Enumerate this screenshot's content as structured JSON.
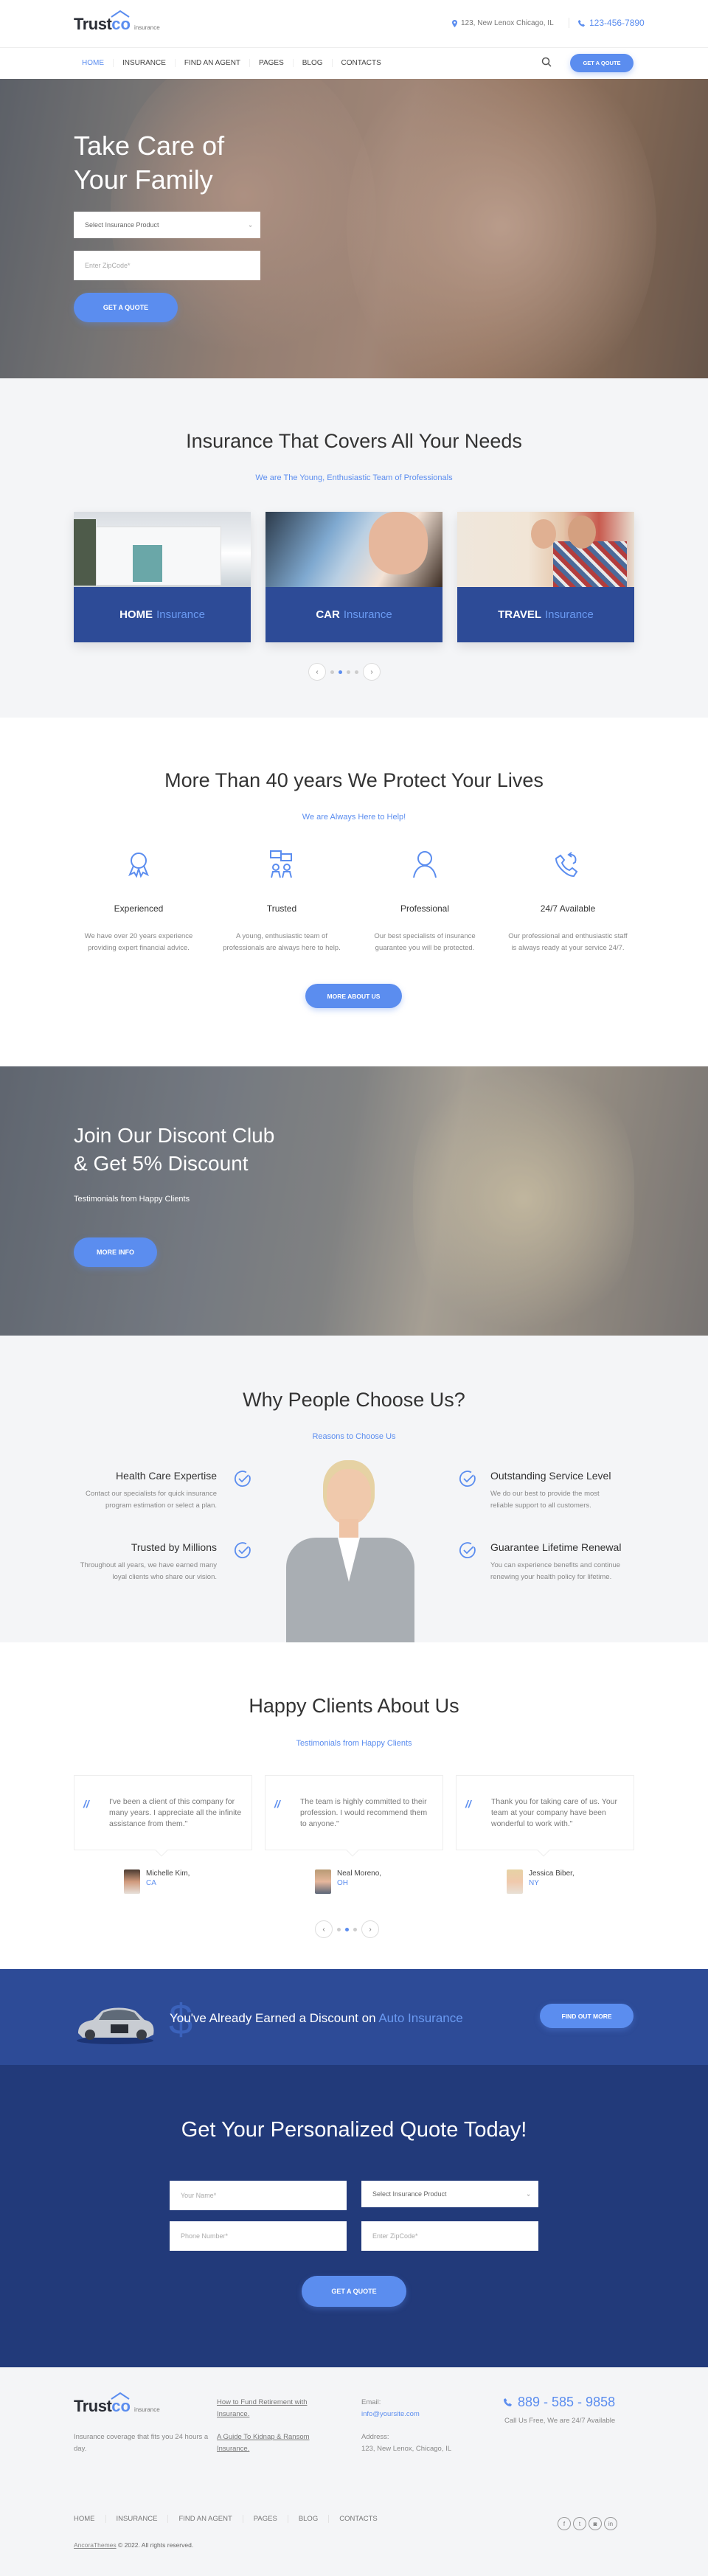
{
  "brand": {
    "name_part1": "Trust",
    "name_part2": "co",
    "tagline": "insurance"
  },
  "topbar": {
    "address": "123, New Lenox Chicago, IL",
    "phone": "123-456-7890"
  },
  "nav": {
    "items": [
      "HOME",
      "INSURANCE",
      "FIND AN AGENT",
      "PAGES",
      "BLOG",
      "CONTACTS"
    ],
    "active": "HOME",
    "cta": "GET A QOUTE"
  },
  "hero": {
    "title_line1": "Take Care of",
    "title_line2": "Your Family",
    "select_placeholder": "Select Insurance Product",
    "zip_placeholder": "Enter ZipCode*",
    "button": "GET A QUOTE"
  },
  "coverage": {
    "title": "Insurance That Covers All Your Needs",
    "subtitle": "We are The Young, Enthusiastic Team of Professionals",
    "cards": [
      {
        "bold": "HOME",
        "light": "Insurance"
      },
      {
        "bold": "CAR",
        "light": "Insurance"
      },
      {
        "bold": "TRAVEL",
        "light": "Insurance"
      }
    ],
    "pager": {
      "dots": 4,
      "active": 2
    }
  },
  "protect": {
    "title": "More Than 40 years We Protect Your Lives",
    "subtitle": "We are Always Here to Help!",
    "features": [
      {
        "icon": "award-ribbon-icon",
        "title": "Experienced",
        "desc_line1": "We have over 20 years experience",
        "desc_line2": "providing expert financial advice."
      },
      {
        "icon": "team-chat-icon",
        "title": "Trusted",
        "desc_line1": "A young, enthusiastic team of",
        "desc_line2": "professionals are always here to help."
      },
      {
        "icon": "user-icon",
        "title": "Professional",
        "desc_line1": "Our best specialists of insurance",
        "desc_line2": "guarantee you will be protected."
      },
      {
        "icon": "phone-callback-icon",
        "title": "24/7 Available",
        "desc_line1": "Our professional and enthusiastic staff",
        "desc_line2": "is always ready at your service 24/7."
      }
    ],
    "button": "MORE ABOUT US"
  },
  "discount": {
    "title_line1": "Join Our Discont Club",
    "title_line2": "& Get 5% Discount",
    "subtitle": "Testimonials from Happy Clients",
    "button": "MORE INFO"
  },
  "why": {
    "title": "Why People Choose Us?",
    "subtitle": "Reasons to Choose Us",
    "left": [
      {
        "title": "Health Care Expertise",
        "desc_line1": "Contact our specialists for quick insurance",
        "desc_line2": "program estimation or select a plan."
      },
      {
        "title": "Trusted by Millions",
        "desc_line1": "Throughout all years, we have earned many",
        "desc_line2": "loyal clients who share our vision."
      }
    ],
    "right": [
      {
        "title": "Outstanding Service Level",
        "desc_line1": "We do our best to provide the most",
        "desc_line2": "reliable support to all customers."
      },
      {
        "title": "Guarantee Lifetime Renewal",
        "desc_line1": "You can experience benefits and continue",
        "desc_line2": "renewing your health policy for lifetime."
      }
    ]
  },
  "testimonials": {
    "title": "Happy Clients About Us",
    "subtitle": "Testimonials from Happy Clients",
    "items": [
      {
        "quote": "I've been a client of this company for many years. I appreciate all the infinite assistance from them.\"",
        "name": "Michelle Kim,",
        "location": "CA"
      },
      {
        "quote": "The team is highly committed to their profession. I would recommend them to anyone.\"",
        "name": "Neal Moreno,",
        "location": "OH"
      },
      {
        "quote": "Thank you for taking care of us. Your team at your company have been wonderful to work with.\"",
        "name": "Jessica Biber,",
        "location": "NY"
      }
    ],
    "pager": {
      "dots": 3,
      "active": 2
    }
  },
  "promo": {
    "text": "You've Already Earned a Discount on ",
    "highlight": "Auto Insurance",
    "button": "FIND OUT MORE"
  },
  "quote_form": {
    "title": "Get Your Personalized Quote Today!",
    "name_placeholder": "Your Name*",
    "select_placeholder": "Select Insurance Product",
    "phone_placeholder": "Phone Number*",
    "zip_placeholder": "Enter ZipCode*",
    "button": "GET A QUOTE"
  },
  "footer": {
    "about": "Insurance coverage that fits you 24 hours a day.",
    "links": [
      "How to Fund Retirement with Insurance.",
      "A Guide To Kidnap & Ransom Insurance."
    ],
    "email_label": "Email:",
    "email": "info@yoursite.com",
    "address_label": "Address:",
    "address": "123, New Lenox, Chicago, IL",
    "phone": "889 - 585 - 9858",
    "phone_note": "Call Us Free, We are 24/7 Available",
    "nav": [
      "HOME",
      "INSURANCE",
      "FIND AN AGENT",
      "PAGES",
      "BLOG",
      "CONTACTS"
    ],
    "copyright_link": "AncoraThemes",
    "copyright": " © 2022. All rights reserved.",
    "social": [
      {
        "icon": "facebook-icon",
        "glyph": "f"
      },
      {
        "icon": "twitter-icon",
        "glyph": "t"
      },
      {
        "icon": "instagram-icon",
        "glyph": "◙"
      },
      {
        "icon": "linkedin-icon",
        "glyph": "in"
      }
    ]
  },
  "colors": {
    "accent": "#5b8def",
    "navy": "#2d4b97",
    "navy_dark": "#223a7a",
    "light_bg": "#f4f5f7"
  }
}
